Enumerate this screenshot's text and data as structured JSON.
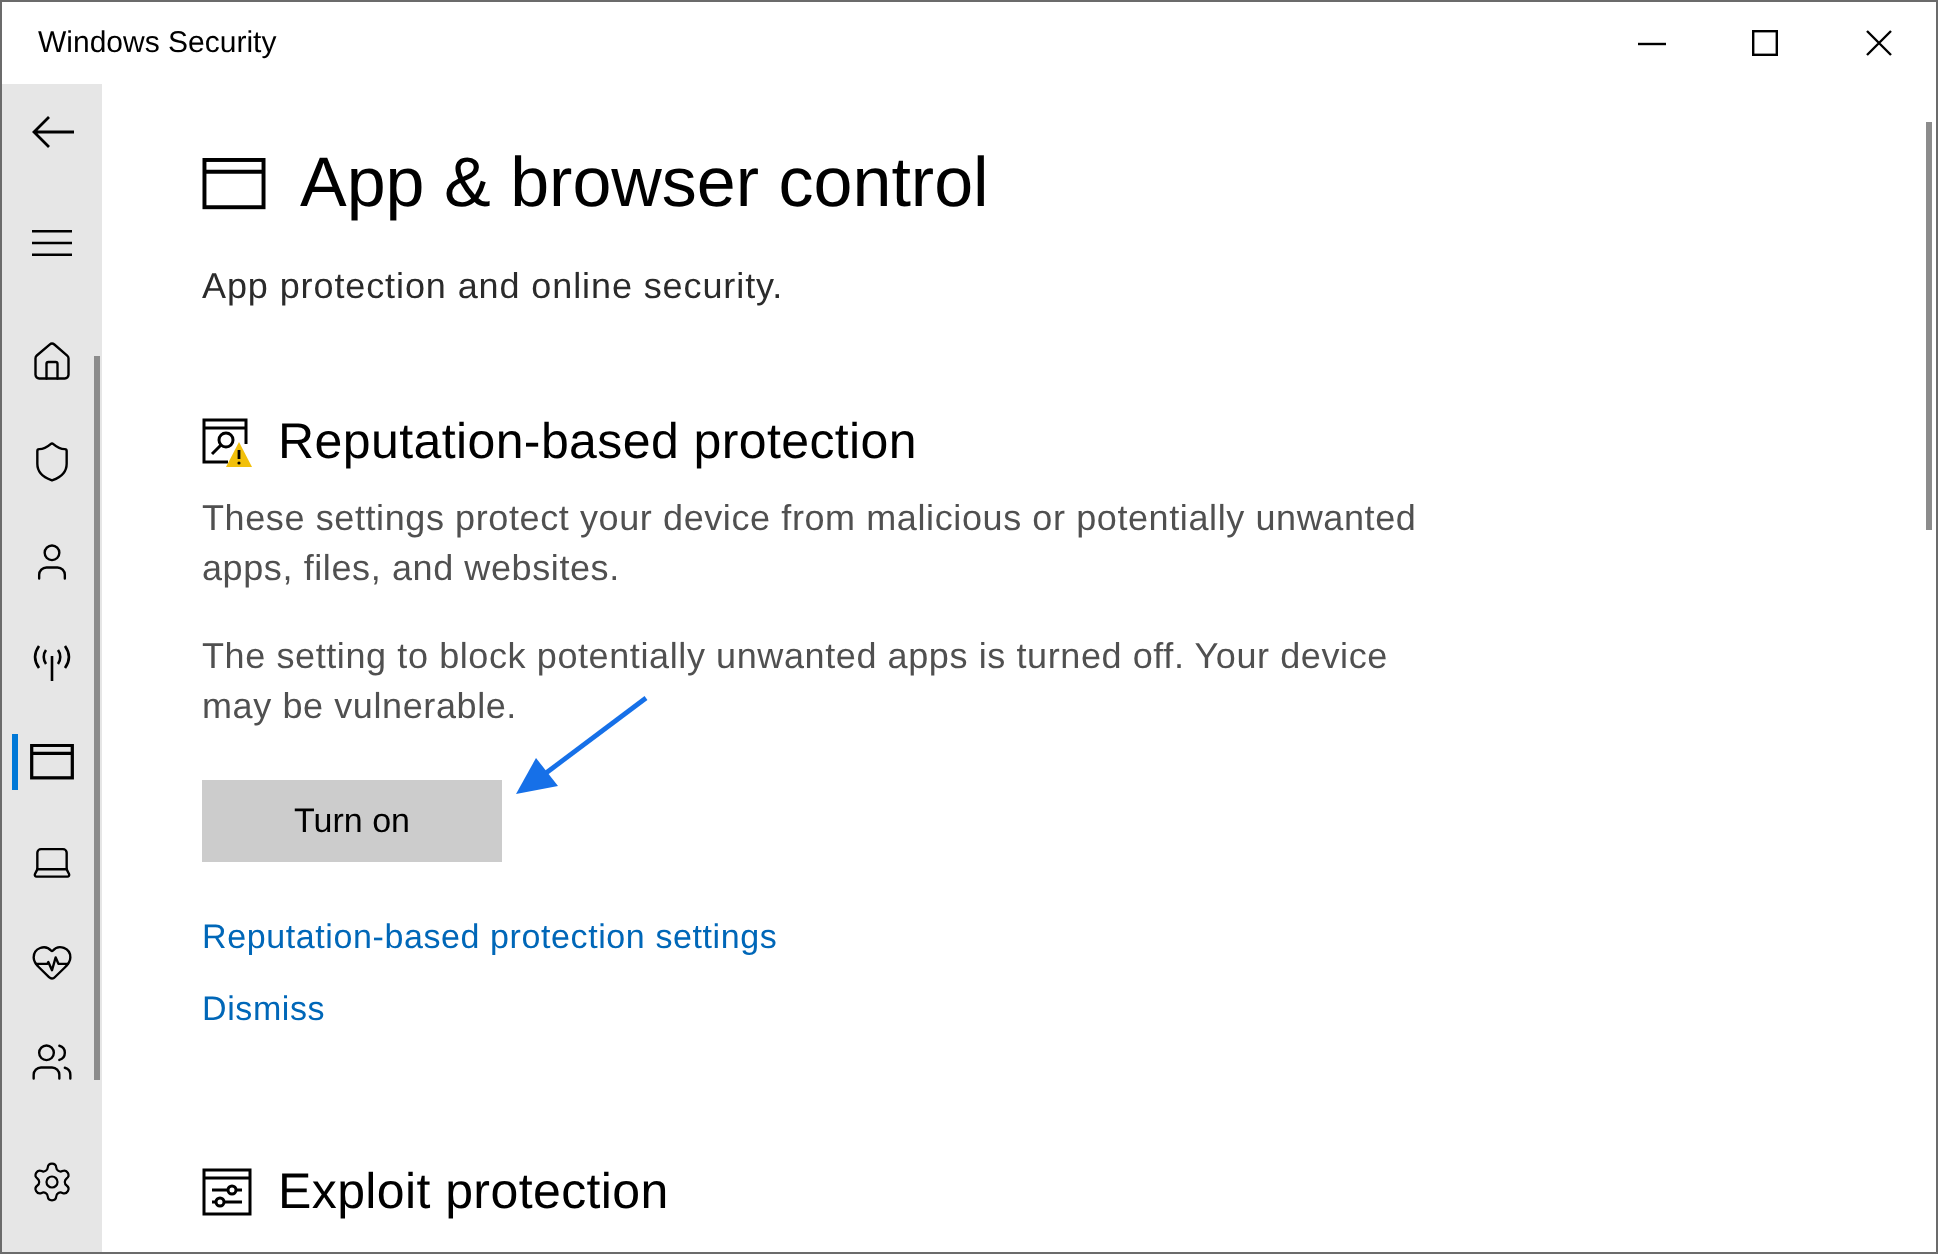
{
  "window": {
    "title": "Windows Security"
  },
  "sidebar": {
    "items": [
      {
        "kind": "home",
        "selected": false
      },
      {
        "kind": "shield",
        "selected": false
      },
      {
        "kind": "account",
        "selected": false
      },
      {
        "kind": "network",
        "selected": false
      },
      {
        "kind": "app",
        "selected": true
      },
      {
        "kind": "device",
        "selected": false
      },
      {
        "kind": "health",
        "selected": false
      },
      {
        "kind": "family",
        "selected": false
      }
    ]
  },
  "page": {
    "title": "App & browser control",
    "subtitle": "App protection and online security."
  },
  "sections": [
    {
      "kind": "reputation",
      "heading": "Reputation-based protection",
      "paragraphs": [
        "These settings protect your device from malicious or potentially unwanted apps, files, and websites.",
        "The setting to block potentially unwanted apps is turned off. Your device may be vulnerable."
      ],
      "button": "Turn on",
      "links": [
        "Reputation-based protection settings",
        "Dismiss"
      ]
    },
    {
      "kind": "exploit",
      "heading": "Exploit protection"
    }
  ]
}
